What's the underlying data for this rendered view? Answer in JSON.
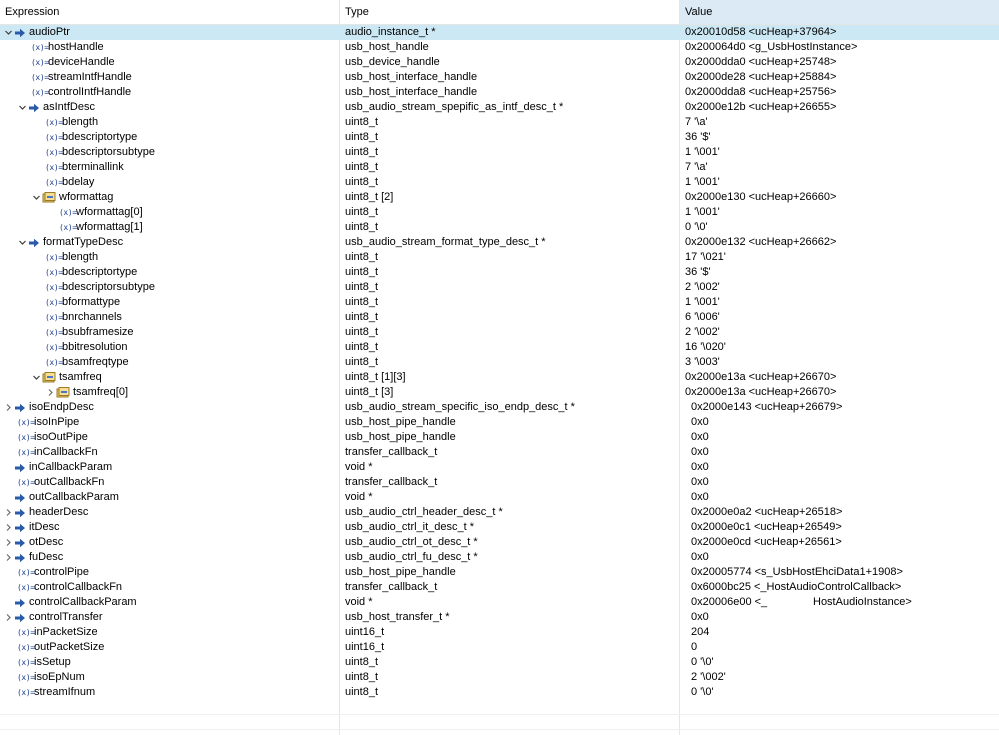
{
  "header": {
    "expression": "Expression",
    "type": "Type",
    "value": "Value"
  },
  "variable_icon_text": "(x)=",
  "rows": [
    {
      "depth": 0,
      "twisty": "expanded",
      "icon": "pointer",
      "name": "audioPtr",
      "type": "audio_instance_t *",
      "value": "0x20010d58 <ucHeap+37964>",
      "selected": true
    },
    {
      "depth": 1,
      "icon": "variable",
      "name": "hostHandle",
      "type": "usb_host_handle",
      "value": "0x200064d0 <g_UsbHostInstance>"
    },
    {
      "depth": 1,
      "icon": "variable",
      "name": "deviceHandle",
      "type": "usb_device_handle",
      "value": "0x2000dda0 <ucHeap+25748>"
    },
    {
      "depth": 1,
      "icon": "variable",
      "name": "streamIntfHandle",
      "type": "usb_host_interface_handle",
      "value": "0x2000de28 <ucHeap+25884>"
    },
    {
      "depth": 1,
      "icon": "variable",
      "name": "controlIntfHandle",
      "type": "usb_host_interface_handle",
      "value": "0x2000dda8 <ucHeap+25756>"
    },
    {
      "depth": 1,
      "twisty": "expanded",
      "icon": "pointer",
      "name": "asIntfDesc",
      "type": "usb_audio_stream_spepific_as_intf_desc_t *",
      "value": "0x2000e12b <ucHeap+26655>"
    },
    {
      "depth": 2,
      "icon": "variable",
      "name": "blength",
      "type": "uint8_t",
      "value": "7 '\\a'"
    },
    {
      "depth": 2,
      "icon": "variable",
      "name": "bdescriptortype",
      "type": "uint8_t",
      "value": "36 '$'"
    },
    {
      "depth": 2,
      "icon": "variable",
      "name": "bdescriptorsubtype",
      "type": "uint8_t",
      "value": "1 '\\001'"
    },
    {
      "depth": 2,
      "icon": "variable",
      "name": "bterminallink",
      "type": "uint8_t",
      "value": "7 '\\a'"
    },
    {
      "depth": 2,
      "icon": "variable",
      "name": "bdelay",
      "type": "uint8_t",
      "value": "1 '\\001'"
    },
    {
      "depth": 2,
      "twisty": "expanded",
      "icon": "array",
      "name": "wformattag",
      "type": "uint8_t [2]",
      "value": "0x2000e130 <ucHeap+26660>"
    },
    {
      "depth": 3,
      "icon": "variable",
      "name": "wformattag[0]",
      "type": "uint8_t",
      "value": "1 '\\001'"
    },
    {
      "depth": 3,
      "icon": "variable",
      "name": "wformattag[1]",
      "type": "uint8_t",
      "value": "0 '\\0'"
    },
    {
      "depth": 1,
      "twisty": "expanded",
      "icon": "pointer",
      "name": "formatTypeDesc",
      "type": "usb_audio_stream_format_type_desc_t *",
      "value": "0x2000e132 <ucHeap+26662>"
    },
    {
      "depth": 2,
      "icon": "variable",
      "name": "blength",
      "type": "uint8_t",
      "value": "17 '\\021'"
    },
    {
      "depth": 2,
      "icon": "variable",
      "name": "bdescriptortype",
      "type": "uint8_t",
      "value": "36 '$'"
    },
    {
      "depth": 2,
      "icon": "variable",
      "name": "bdescriptorsubtype",
      "type": "uint8_t",
      "value": "2 '\\002'"
    },
    {
      "depth": 2,
      "icon": "variable",
      "name": "bformattype",
      "type": "uint8_t",
      "value": "1 '\\001'"
    },
    {
      "depth": 2,
      "icon": "variable",
      "name": "bnrchannels",
      "type": "uint8_t",
      "value": "6 '\\006'"
    },
    {
      "depth": 2,
      "icon": "variable",
      "name": "bsubframesize",
      "type": "uint8_t",
      "value": "2 '\\002'"
    },
    {
      "depth": 2,
      "icon": "variable",
      "name": "bbitresolution",
      "type": "uint8_t",
      "value": "16 '\\020'"
    },
    {
      "depth": 2,
      "icon": "variable",
      "name": "bsamfreqtype",
      "type": "uint8_t",
      "value": "3 '\\003'"
    },
    {
      "depth": 2,
      "twisty": "expanded",
      "icon": "array",
      "name": "tsamfreq",
      "type": "uint8_t [1][3]",
      "value": "0x2000e13a <ucHeap+26670>"
    },
    {
      "depth": 3,
      "twisty": "collapsed",
      "icon": "array",
      "name": "tsamfreq[0]",
      "type": "uint8_t [3]",
      "value": "0x2000e13a <ucHeap+26670>"
    },
    {
      "depth": 0,
      "twisty": "collapsed",
      "icon": "pointer",
      "name": "isoEndpDesc",
      "type": "usb_audio_stream_specific_iso_endp_desc_t *",
      "value": "0x2000e143 <ucHeap+26679>",
      "value_indent": true
    },
    {
      "depth": 0,
      "icon": "variable",
      "name": "isoInPipe",
      "type": "usb_host_pipe_handle",
      "value": "0x0",
      "value_indent": true
    },
    {
      "depth": 0,
      "icon": "variable",
      "name": "isoOutPipe",
      "type": "usb_host_pipe_handle",
      "value": "0x0",
      "value_indent": true
    },
    {
      "depth": 0,
      "icon": "variable",
      "name": "inCallbackFn",
      "type": "transfer_callback_t",
      "value": "0x0",
      "value_indent": true
    },
    {
      "depth": 0,
      "icon": "pointer",
      "name": "inCallbackParam",
      "type": "void *",
      "value": "0x0",
      "value_indent": true
    },
    {
      "depth": 0,
      "icon": "variable",
      "name": "outCallbackFn",
      "type": "transfer_callback_t",
      "value": "0x0",
      "value_indent": true
    },
    {
      "depth": 0,
      "icon": "pointer",
      "name": "outCallbackParam",
      "type": "void *",
      "value": "0x0",
      "value_indent": true
    },
    {
      "depth": 0,
      "twisty": "collapsed",
      "icon": "pointer",
      "name": "headerDesc",
      "type": "usb_audio_ctrl_header_desc_t *",
      "value": "0x2000e0a2 <ucHeap+26518>",
      "value_indent": true
    },
    {
      "depth": 0,
      "twisty": "collapsed",
      "icon": "pointer",
      "name": "itDesc",
      "type": "usb_audio_ctrl_it_desc_t *",
      "value": "0x2000e0c1 <ucHeap+26549>",
      "value_indent": true
    },
    {
      "depth": 0,
      "twisty": "collapsed",
      "icon": "pointer",
      "name": "otDesc",
      "type": "usb_audio_ctrl_ot_desc_t *",
      "value": "0x2000e0cd <ucHeap+26561>",
      "value_indent": true
    },
    {
      "depth": 0,
      "twisty": "collapsed",
      "icon": "pointer",
      "name": "fuDesc",
      "type": "usb_audio_ctrl_fu_desc_t *",
      "value": "0x0",
      "value_indent": true
    },
    {
      "depth": 0,
      "icon": "variable",
      "name": "controlPipe",
      "type": "usb_host_pipe_handle",
      "value": "0x20005774 <s_UsbHostEhciData1+1908>",
      "value_indent": true
    },
    {
      "depth": 0,
      "icon": "variable",
      "name": "controlCallbackFn",
      "type": "transfer_callback_t",
      "value": "0x6000bc25 <_HostAudioControlCallback>",
      "value_indent": true
    },
    {
      "depth": 0,
      "icon": "pointer",
      "name": "controlCallbackParam",
      "type": "void *",
      "value": "0x20006e00 <_               HostAudioInstance>",
      "value_indent": true
    },
    {
      "depth": 0,
      "twisty": "collapsed",
      "icon": "pointer",
      "name": "controlTransfer",
      "type": "usb_host_transfer_t *",
      "value": "0x0",
      "value_indent": true
    },
    {
      "depth": 0,
      "icon": "variable",
      "name": "inPacketSize",
      "type": "uint16_t",
      "value": "204",
      "value_indent": true
    },
    {
      "depth": 0,
      "icon": "variable",
      "name": "outPacketSize",
      "type": "uint16_t",
      "value": "0",
      "value_indent": true
    },
    {
      "depth": 0,
      "icon": "variable",
      "name": "isSetup",
      "type": "uint8_t",
      "value": "0 '\\0'",
      "value_indent": true
    },
    {
      "depth": 0,
      "icon": "variable",
      "name": "isoEpNum",
      "type": "uint8_t",
      "value": "2 '\\002'",
      "value_indent": true
    },
    {
      "depth": 0,
      "icon": "variable",
      "name": "streamIfnum",
      "type": "uint8_t",
      "value": "0 '\\0'",
      "value_indent": true
    }
  ]
}
